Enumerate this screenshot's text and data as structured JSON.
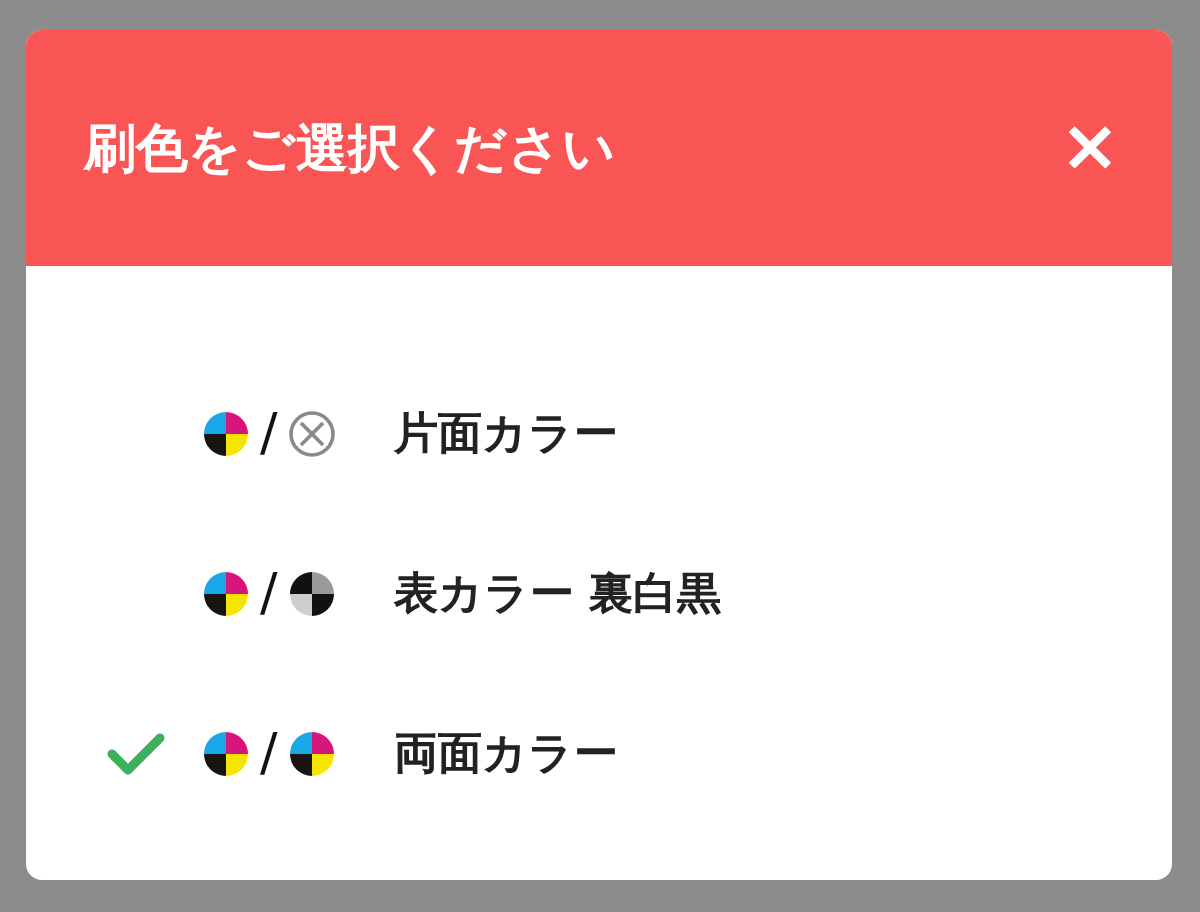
{
  "dialog": {
    "title": "刷色をご選択ください",
    "close": "×"
  },
  "options": [
    {
      "label": "片面カラー",
      "selected": false,
      "front": {
        "kind": "cmyk"
      },
      "separator": "/",
      "back": {
        "kind": "none"
      }
    },
    {
      "label": "表カラー 裏白黒",
      "selected": false,
      "front": {
        "kind": "cmyk"
      },
      "separator": "/",
      "back": {
        "kind": "mono"
      }
    },
    {
      "label": "両面カラー",
      "selected": true,
      "front": {
        "kind": "cmyk"
      },
      "separator": "/",
      "back": {
        "kind": "cmyk"
      }
    }
  ]
}
